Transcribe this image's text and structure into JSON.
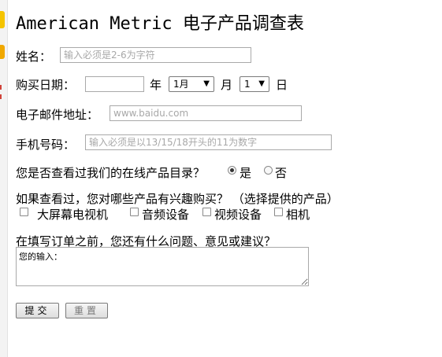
{
  "title": "American Metric 电子产品调查表",
  "form": {
    "name_label": "姓名：",
    "name_placeholder": "输入必须是2-6为字符",
    "date_label": "购买日期：",
    "year_value": "",
    "year_unit": "年",
    "month_value": "1月",
    "month_unit": "月",
    "day_value": "1",
    "day_unit": "日",
    "email_label": "电子邮件地址：",
    "email_placeholder": "www.baidu.com",
    "phone_label": "手机号码：",
    "phone_placeholder": "输入必须是以13/15/18开头的11为数字",
    "catalog_question": "您是否查看过我们的在线产品目录？",
    "radio_yes": "是",
    "radio_no": "否",
    "radio_selected": "yes",
    "interest_question": "如果查看过，您对哪些产品有兴趣购买？ （选择提供的产品）",
    "products": [
      "大屏幕电视机",
      "音频设备",
      "视频设备",
      "相机"
    ],
    "feedback_question": "在填写订单之前，您还有什么问题、意见或建议？",
    "feedback_value": "您的输入：",
    "submit_label": "提交",
    "reset_label": "重置"
  }
}
